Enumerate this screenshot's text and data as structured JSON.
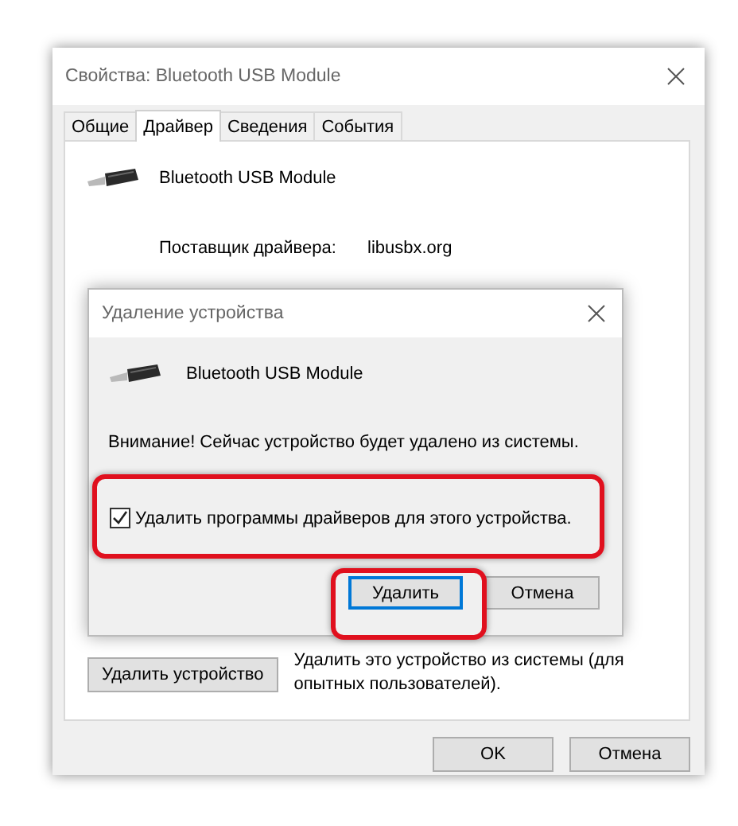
{
  "window": {
    "title": "Свойства: Bluetooth USB Module"
  },
  "tabs": [
    {
      "label": "Общие",
      "selected": false
    },
    {
      "label": "Драйвер",
      "selected": true
    },
    {
      "label": "Сведения",
      "selected": false
    },
    {
      "label": "События",
      "selected": false
    }
  ],
  "device": {
    "name": "Bluetooth USB Module"
  },
  "properties": [
    {
      "label": "Поставщик драйвера:",
      "value": "libusbx.org"
    }
  ],
  "uninstall": {
    "button": "Удалить устройство",
    "description": "Удалить это устройство из системы (для опытных пользователей)."
  },
  "buttons": [
    "OK",
    "Отмена"
  ],
  "dialog": {
    "title": "Удаление устройства",
    "device_name": "Bluetooth USB Module",
    "warning": "Внимание! Сейчас устройство будет удалено из системы.",
    "checkbox": {
      "label": "Удалить программы драйверов для этого устройства.",
      "checked": true
    },
    "buttons": [
      {
        "label": "Удалить",
        "default": true
      },
      {
        "label": "Отмена",
        "default": false
      }
    ]
  }
}
